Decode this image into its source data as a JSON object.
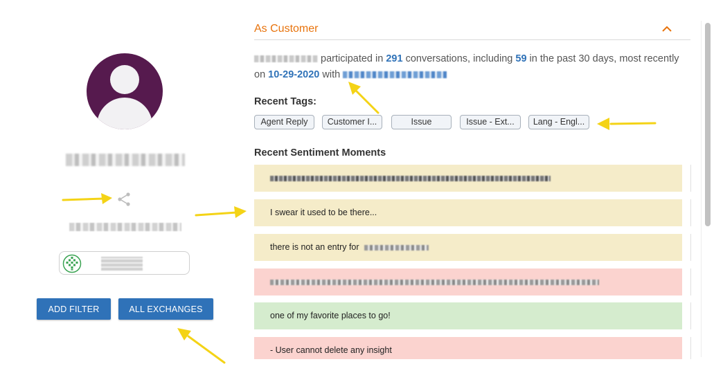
{
  "section": {
    "title": "As Customer",
    "collapse_icon": "chevron-up-icon",
    "accent_color": "#e8730c"
  },
  "summary": {
    "text_participated": "participated in",
    "conversations": "291",
    "text_conversations": "conversations, including",
    "recent_count": "59",
    "text_past": "in the past 30 days, most recently on",
    "last_date": "10-29-2020",
    "text_with": "with"
  },
  "recent_tags": {
    "label": "Recent Tags:",
    "items": [
      "Agent Reply",
      "Customer I...",
      "Issue",
      "Issue - Ext...",
      "Lang - Engl..."
    ]
  },
  "sentiment": {
    "label": "Recent Sentiment Moments",
    "items": [
      {
        "text": "",
        "tone": "neutral",
        "color": "#f5ecc9"
      },
      {
        "text": "I swear it used to be there...",
        "tone": "neutral",
        "color": "#f5ecc9"
      },
      {
        "text": "there is not an entry for",
        "tone": "neutral",
        "color": "#f5ecc9"
      },
      {
        "text": "",
        "tone": "negative",
        "color": "#fbd3cf"
      },
      {
        "text": "one of my favorite places to go!",
        "tone": "positive",
        "color": "#d5ecce"
      },
      {
        "text": "- User cannot delete any insight",
        "tone": "negative",
        "color": "#fbd3cf"
      }
    ]
  },
  "profile": {
    "avatar_color": "#561a4e",
    "share_icon": "share-icon",
    "account_logo_icon": "green-diamond-logo-icon"
  },
  "buttons": {
    "add_filter": "ADD FILTER",
    "all_exchanges": "ALL EXCHANGES",
    "color": "#2f72b8"
  },
  "annotations": {
    "arrow_color": "#f4d316"
  }
}
